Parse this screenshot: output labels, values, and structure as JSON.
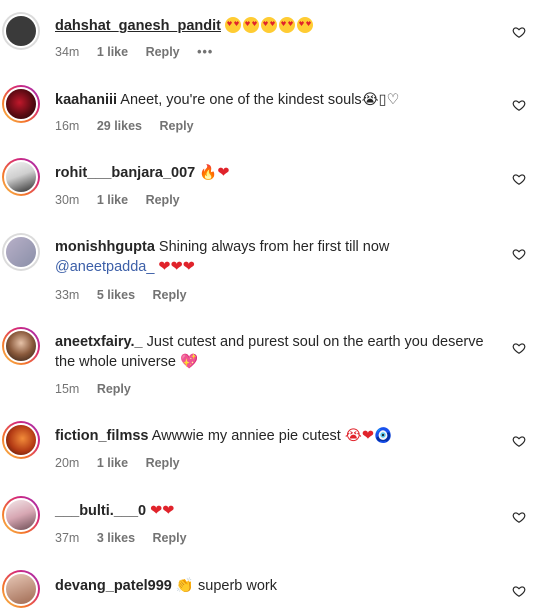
{
  "comments": [
    {
      "username": "dahshat_ganesh_pandit",
      "text": "",
      "emoji": "😍😍😍😍😍",
      "time": "34m",
      "likes": "1 like",
      "reply": "Reply",
      "more": "•••"
    },
    {
      "username": "kaahaniii",
      "text": "Aneet, you're one of the kindest souls",
      "emoji": "😭▯♡",
      "time": "16m",
      "likes": "29 likes",
      "reply": "Reply"
    },
    {
      "username": "rohit___banjara_007",
      "text": "",
      "emoji": "🔥❤",
      "time": "30m",
      "likes": "1 like",
      "reply": "Reply"
    },
    {
      "username": "monishhgupta",
      "text": "Shining always from her first till now",
      "mention": "@aneetpadda_",
      "emoji": "❤❤❤",
      "time": "33m",
      "likes": "5 likes",
      "reply": "Reply"
    },
    {
      "username": "aneetxfairy._",
      "text": "Just cutest and purest soul on the earth you deserve the whole universe",
      "emoji": "💖",
      "time": "15m",
      "reply": "Reply"
    },
    {
      "username": "fiction_filmss",
      "text": "Awwwie my anniee pie cutest",
      "emoji": "😭❤🧿",
      "time": "20m",
      "likes": "1 like",
      "reply": "Reply"
    },
    {
      "username": "___bulti.___0",
      "text": "",
      "emoji": "❤❤",
      "time": "37m",
      "likes": "3 likes",
      "reply": "Reply"
    },
    {
      "username": "devang_patel999",
      "text": "superb work",
      "emoji": "👏"
    }
  ],
  "colors": {
    "text": "#262626",
    "meta": "#737373",
    "mention": "#3c5fa8",
    "heart_emoji": "#e0232b"
  },
  "icons": {
    "like": "heart-outline-icon"
  }
}
